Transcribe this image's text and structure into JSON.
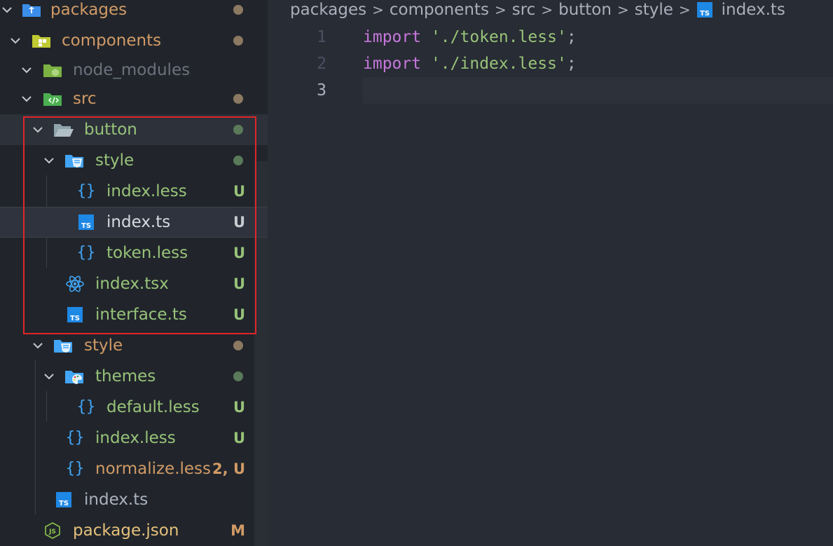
{
  "explorer": {
    "rows": [
      {
        "label": "packages",
        "status": "",
        "color": "#d19a66",
        "icon": "folder-open-blue-icon"
      },
      {
        "label": "components",
        "status": "",
        "color": "#d19a66",
        "icon": "folder-open-yellow-icon"
      },
      {
        "label": "node_modules",
        "status": "",
        "color": "#6b717d",
        "icon": "folder-node-icon"
      },
      {
        "label": "src",
        "status": "",
        "color": "#d19a66",
        "icon": "folder-src-icon"
      },
      {
        "label": "button",
        "status": "",
        "color": "#98c379",
        "icon": "folder-open-gray-icon"
      },
      {
        "label": "style",
        "status": "",
        "color": "#98c379",
        "icon": "folder-style-icon"
      },
      {
        "label": "index.less",
        "status": "U",
        "color": "#98c379",
        "icon": "braces-icon"
      },
      {
        "label": "index.ts",
        "status": "U",
        "color": "#d7dae0",
        "icon": "typescript-icon"
      },
      {
        "label": "token.less",
        "status": "U",
        "color": "#98c379",
        "icon": "braces-icon"
      },
      {
        "label": "index.tsx",
        "status": "U",
        "color": "#98c379",
        "icon": "react-icon"
      },
      {
        "label": "interface.ts",
        "status": "U",
        "color": "#98c379",
        "icon": "typescript-icon"
      },
      {
        "label": "style",
        "status": "",
        "color": "#d19a66",
        "icon": "folder-style-icon"
      },
      {
        "label": "themes",
        "status": "",
        "color": "#98c379",
        "icon": "folder-themes-icon"
      },
      {
        "label": "default.less",
        "status": "U",
        "color": "#98c379",
        "icon": "braces-icon"
      },
      {
        "label": "index.less",
        "status": "U",
        "color": "#98c379",
        "icon": "braces-icon"
      },
      {
        "label": "normalize.less",
        "status": "2, U",
        "color": "#d19a66",
        "icon": "braces-icon"
      },
      {
        "label": "index.ts",
        "status": "",
        "color": "#abb2bf",
        "icon": "typescript-icon"
      },
      {
        "label": "package.json",
        "status": "M",
        "color": "#e5c07b",
        "icon": "javascript-icon"
      }
    ]
  },
  "breadcrumb": {
    "items": [
      "packages",
      "components",
      "src",
      "button",
      "style",
      "index.ts"
    ]
  },
  "editor": {
    "lines": [
      {
        "num": "1",
        "keyword": "import",
        "string": "'./token.less'",
        "punct": ";"
      },
      {
        "num": "2",
        "keyword": "import",
        "string": "'./index.less'",
        "punct": ";"
      },
      {
        "num": "3",
        "keyword": "",
        "string": "",
        "punct": ""
      }
    ]
  },
  "colors": {
    "sidebar_bg": "#21252b",
    "editor_bg": "#282c34",
    "untracked": "#98c379",
    "modified": "#d19a66",
    "highlight_box": "#e0262b",
    "keyword": "#c678dd",
    "string": "#98c379"
  }
}
